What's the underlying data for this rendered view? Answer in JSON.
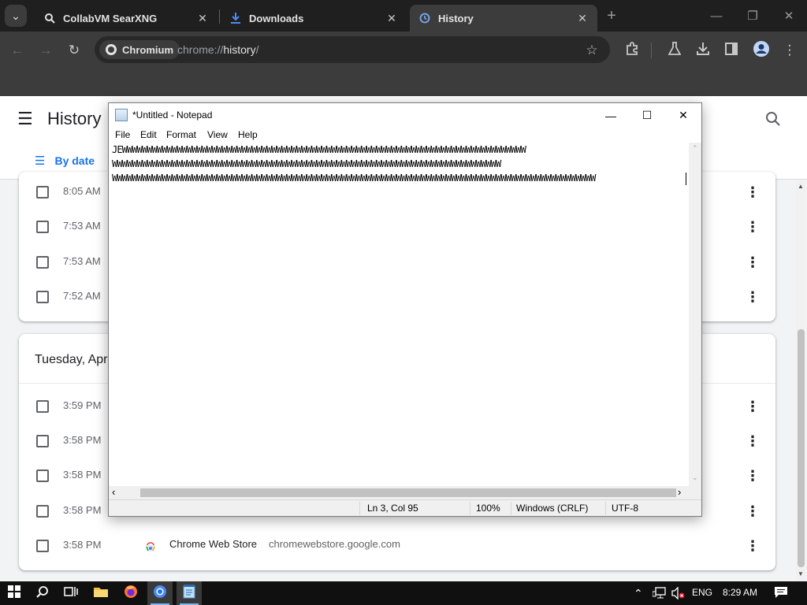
{
  "browser": {
    "tabs": [
      {
        "label": "CollabVM SearXNG",
        "icon": "search-engine-icon",
        "active": false
      },
      {
        "label": "Downloads",
        "icon": "download-icon",
        "active": false
      },
      {
        "label": "History",
        "icon": "history-icon",
        "active": true
      }
    ],
    "origin_chip": "Chromium",
    "url_prefix": "chrome://",
    "url_host": "history",
    "url_suffix": "/"
  },
  "history": {
    "title": "History",
    "tab_label": "By date",
    "group1": {
      "rows": [
        {
          "time": "8:05 AM"
        },
        {
          "time": "7:53 AM"
        },
        {
          "time": "7:53 AM"
        },
        {
          "time": "7:52 AM"
        }
      ]
    },
    "group2": {
      "date_label": "Tuesday, Apr",
      "rows": [
        {
          "time": "3:59 PM"
        },
        {
          "time": "3:58 PM"
        },
        {
          "time": "3:58 PM"
        },
        {
          "time": "3:58 PM"
        },
        {
          "time": "3:58 PM",
          "title": "Chrome Web Store",
          "domain": "chromewebstore.google.com"
        }
      ]
    }
  },
  "notepad": {
    "title": "*Untitled - Notepad",
    "menus": [
      "File",
      "Edit",
      "Format",
      "View",
      "Help"
    ],
    "lines": [
      "JEWWWWWWWWWWWWWWWWWWWWWWWWWWWWWWWWWWWWWWWWWWWWWWWWWWWWWWWWWWWWWWWWWWWWWWWWWWWWWWWWW",
      "WWWWWWWWWWWWWWWWWWWWWWWWWWWWWWWWWWWWWWWWWWWWWWWWWWWWWWWWWWWWWWWWWWWWWWWWWWWWWW",
      "WWWWWWWWWWWWWWWWWWWWWWWWWWWWWWWWWWWWWWWWWWWWWWWWWWWWWWWWWWWWWWWWWWWWWWWWWWWWWWWWWWWWWWWWWWWWWWWWW"
    ],
    "status": {
      "position": "Ln 3, Col 95",
      "zoom": "100%",
      "line_ending": "Windows (CRLF)",
      "encoding": "UTF-8"
    }
  },
  "taskbar": {
    "language": "ENG",
    "clock": "8:29 AM"
  },
  "colors": {
    "chrome_dark": "#1f1f1f",
    "chrome_toolbar": "#3c3c3c",
    "history_accent": "#1a73e8",
    "taskbar": "#101010"
  }
}
